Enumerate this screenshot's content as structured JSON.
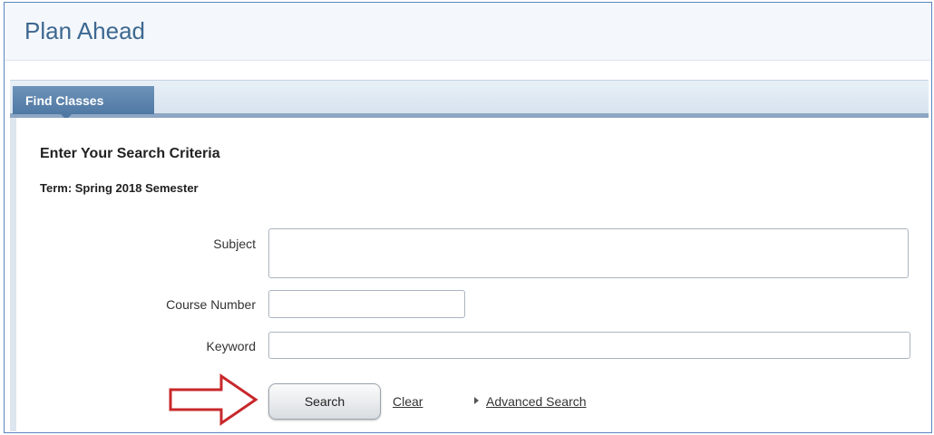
{
  "header": {
    "title": "Plan Ahead"
  },
  "tabs": [
    {
      "label": "Find Classes",
      "active": true
    }
  ],
  "form": {
    "heading": "Enter Your Search Criteria",
    "term": "Term: Spring 2018 Semester",
    "fields": {
      "subject": {
        "label": "Subject",
        "value": ""
      },
      "course_number": {
        "label": "Course Number",
        "value": ""
      },
      "keyword": {
        "label": "Keyword",
        "value": ""
      }
    },
    "actions": {
      "search_label": "Search",
      "clear_label": "Clear",
      "advanced_label": "Advanced Search"
    }
  },
  "colors": {
    "title": "#3d6891",
    "tab_active": "#4f78a3",
    "frame_border": "#5b86c0",
    "annotation_arrow": "#c8282b"
  },
  "icons": [
    "expand-triangle-icon",
    "red-arrow-icon"
  ]
}
